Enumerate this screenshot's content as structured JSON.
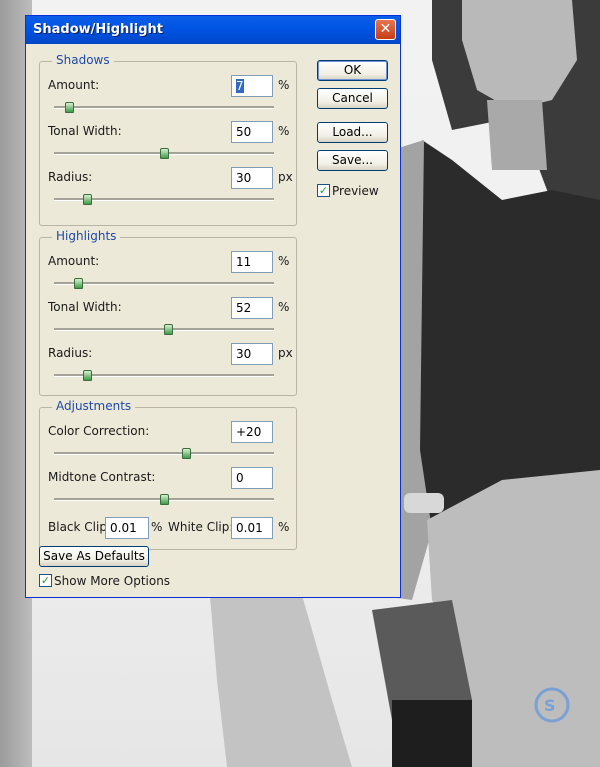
{
  "dialog": {
    "title": "Shadow/Highlight",
    "close_glyph": "✕"
  },
  "shadows": {
    "title": "Shadows",
    "amount": {
      "label": "Amount:",
      "value": "7",
      "unit": "%",
      "level": 0.07
    },
    "tonal_width": {
      "label": "Tonal Width:",
      "value": "50",
      "unit": "%",
      "level": 0.5
    },
    "radius": {
      "label": "Radius:",
      "value": "30",
      "unit": "px",
      "level": 0.15
    }
  },
  "highlights": {
    "title": "Highlights",
    "amount": {
      "label": "Amount:",
      "value": "11",
      "unit": "%",
      "level": 0.11
    },
    "tonal_width": {
      "label": "Tonal Width:",
      "value": "52",
      "unit": "%",
      "level": 0.52
    },
    "radius": {
      "label": "Radius:",
      "value": "30",
      "unit": "px",
      "level": 0.15
    }
  },
  "adjustments": {
    "title": "Adjustments",
    "color_correction": {
      "label": "Color Correction:",
      "value": "+20",
      "level": 0.6
    },
    "midtone_contrast": {
      "label": "Midtone Contrast:",
      "value": "0",
      "level": 0.5
    },
    "black_clip": {
      "label": "Black Clip:",
      "value": "0.01",
      "unit": "%"
    },
    "white_clip": {
      "label": "White Clip:",
      "value": "0.01",
      "unit": "%"
    }
  },
  "buttons": {
    "ok": "OK",
    "cancel": "Cancel",
    "load": "Load...",
    "save": "Save...",
    "save_defaults": "Save As Defaults"
  },
  "checkboxes": {
    "preview": {
      "label": "Preview",
      "checked": true
    },
    "show_more": {
      "label": "Show More Options",
      "checked": true
    }
  },
  "colors": {
    "titlebar": "#0054e3",
    "dialog_bg": "#ece9d8",
    "group_title": "#1f49a6",
    "slider_thumb": "#3f9b48"
  }
}
